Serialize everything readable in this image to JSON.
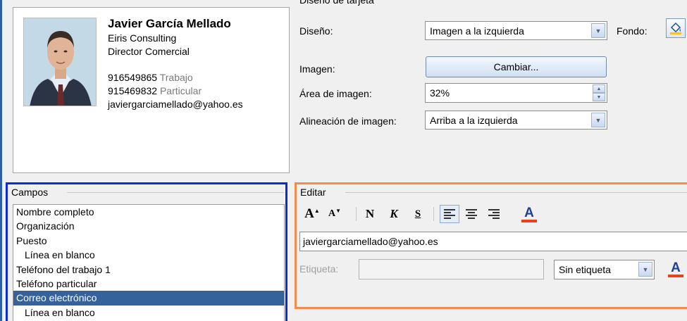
{
  "card": {
    "name": "Javier García Mellado",
    "company": "Eiris Consulting",
    "title": "Director Comercial",
    "phone_work": "916549865",
    "phone_work_label": "Trabajo",
    "phone_home": "915469832",
    "phone_home_label": "Particular",
    "email": "javiergarciamellado@yahoo.es"
  },
  "card_design": {
    "section_title": "Diseño de tarjeta",
    "design_label": "Diseño:",
    "design_value": "Imagen a la izquierda",
    "background_label": "Fondo:",
    "image_label": "Imagen:",
    "change_button": "Cambiar...",
    "image_area_label": "Área de imagen:",
    "image_area_value": "32%",
    "image_align_label": "Alineación de imagen:",
    "image_align_value": "Arriba a la izquierda"
  },
  "fields": {
    "title": "Campos",
    "items": [
      "Nombre completo",
      "Organización",
      "Puesto",
      "Línea en blanco",
      "Teléfono del trabajo 1",
      "Teléfono particular",
      "Correo electrónico",
      "Línea en blanco"
    ],
    "selected_index": 6
  },
  "edit": {
    "title": "Editar",
    "grow_font": "A",
    "shrink_font": "A",
    "bold": "N",
    "italic": "K",
    "underline": "S",
    "font_color": "A",
    "text_value": "javiergarciamellado@yahoo.es",
    "label_label": "Etiqueta:",
    "label_value": "",
    "label_position": "Sin etiqueta",
    "label_color": "A"
  },
  "colors": {
    "fields_highlight": "#0d2bd0",
    "edit_highlight": "#f38b4d",
    "selected_row": "#35629b",
    "font_color_underline": "#e8421c"
  }
}
